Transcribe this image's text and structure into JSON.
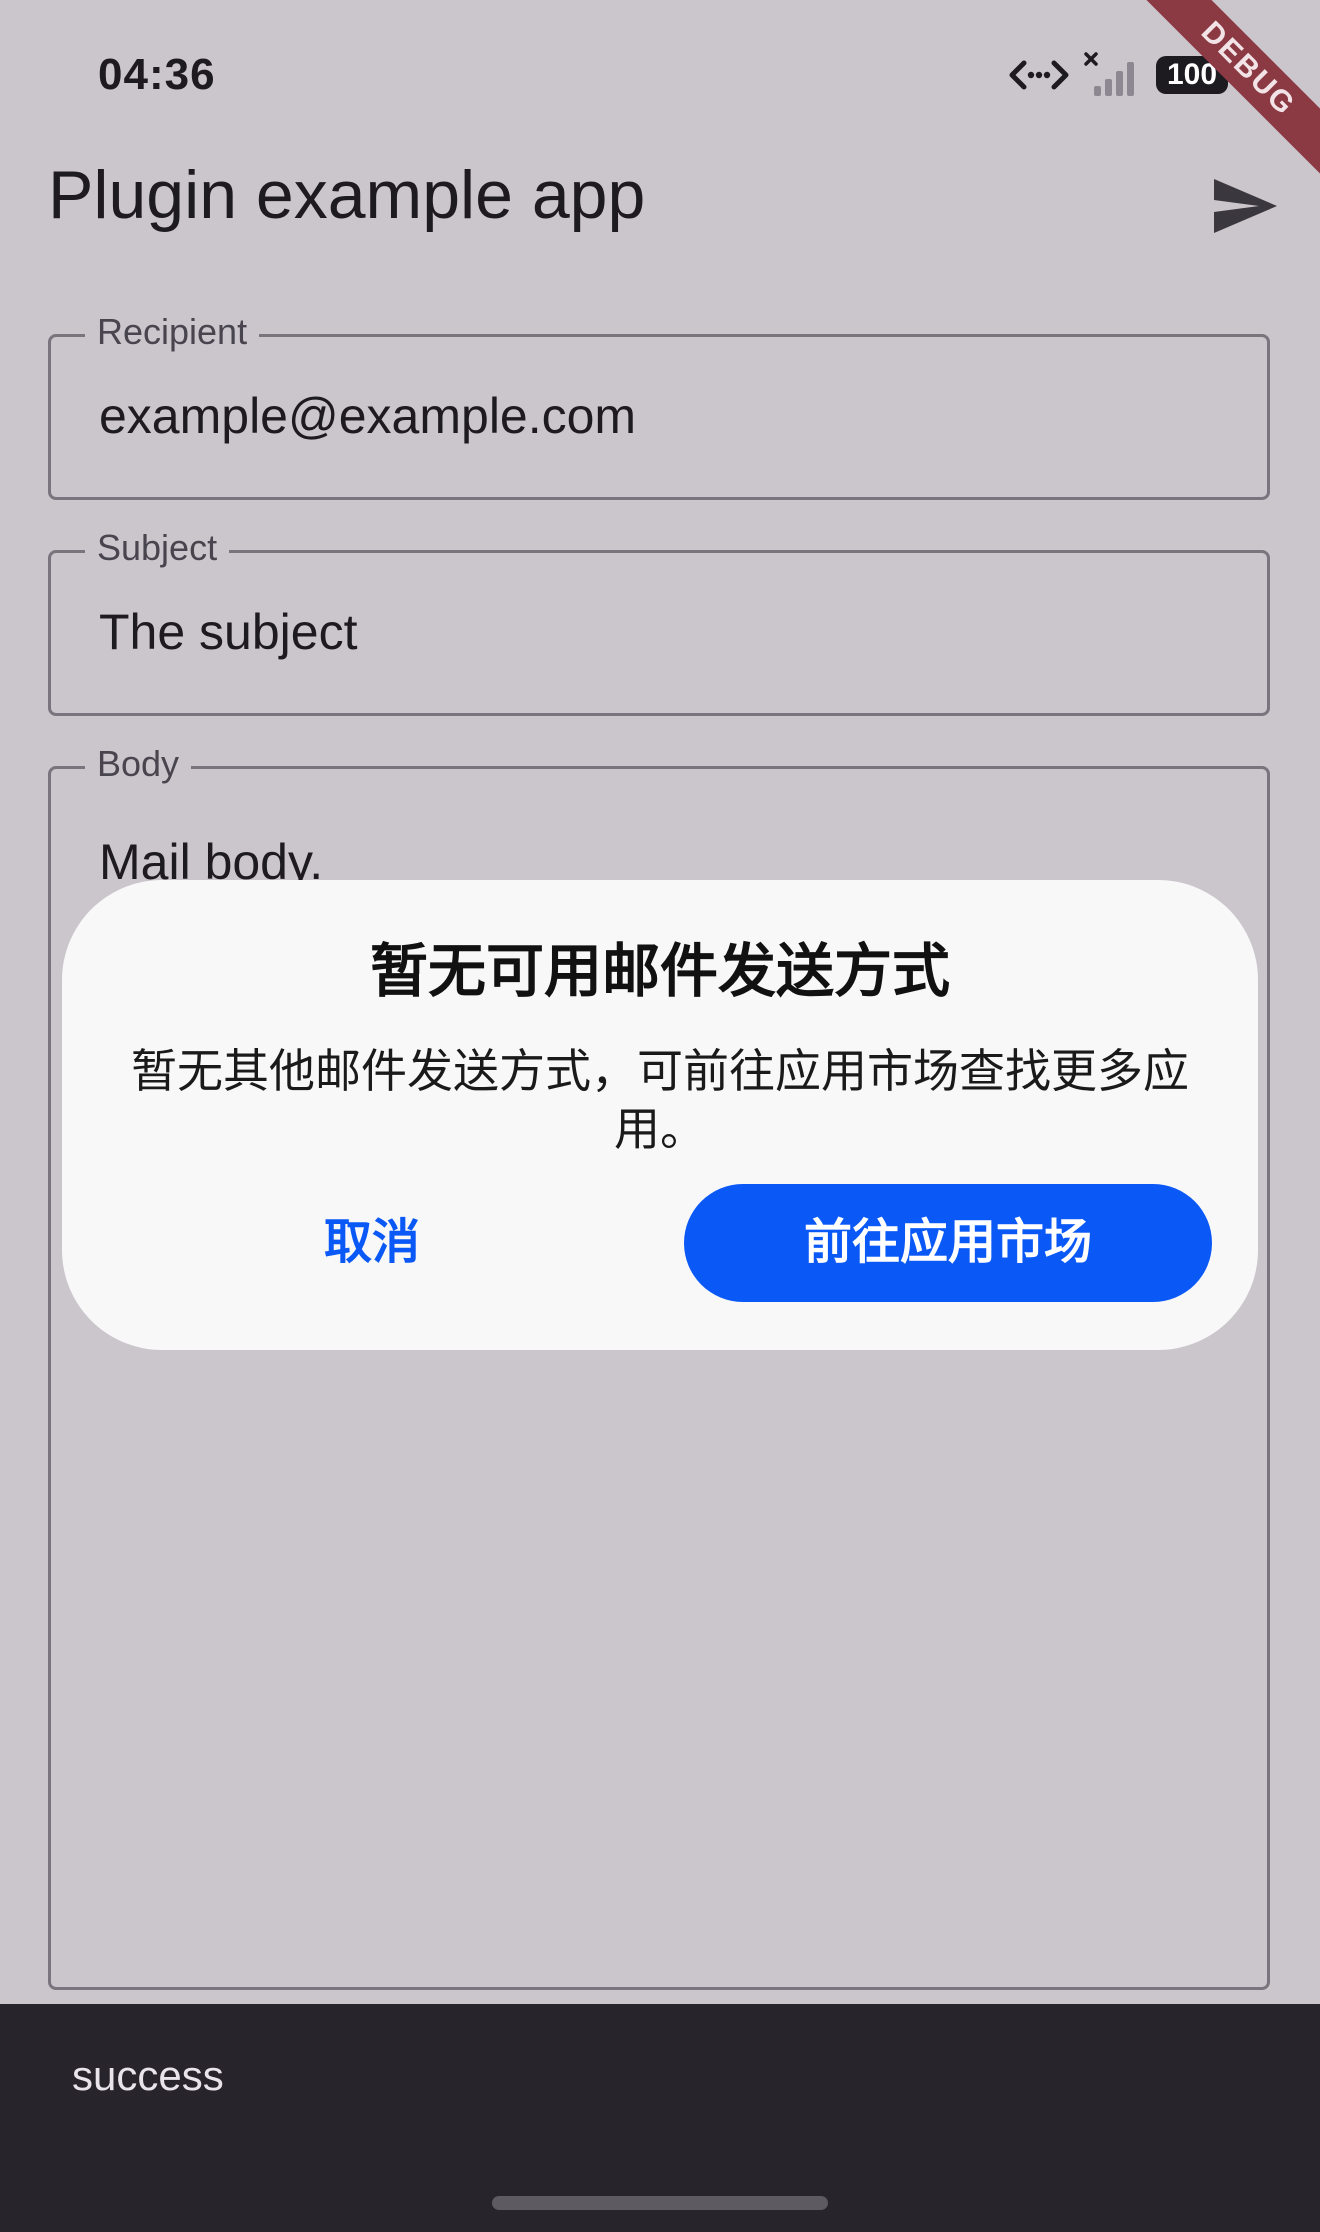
{
  "status_bar": {
    "time": "04:36",
    "battery": "100",
    "debug_banner": "DEBUG",
    "icons": [
      "data-transfer-icon",
      "signal-off-icon",
      "battery-icon"
    ]
  },
  "app_bar": {
    "title": "Plugin example app",
    "action_icon": "send-icon"
  },
  "form": {
    "recipient": {
      "label": "Recipient",
      "value": "example@example.com"
    },
    "subject": {
      "label": "Subject",
      "value": "The subject"
    },
    "body": {
      "label": "Body",
      "value": "Mail body."
    }
  },
  "dialog": {
    "title": "暂无可用邮件发送方式",
    "message": "暂无其他邮件发送方式，可前往应用市场查找更多应用。",
    "cancel_label": "取消",
    "confirm_label": "前往应用市场"
  },
  "snackbar": {
    "message": "success"
  },
  "colors": {
    "background": "#cbc6cc",
    "accent": "#0a59f7",
    "snackbar": "#27242b",
    "debug_ribbon": "#8b3a44"
  }
}
